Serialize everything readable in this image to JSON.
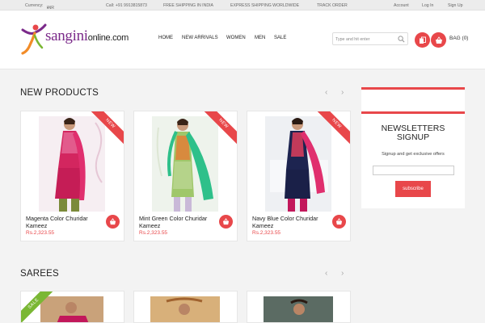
{
  "topbar": {
    "currency_label": "Currency:",
    "currency_value": "INR",
    "call": "Call: +91 9913815873",
    "free_shipping": "FREE SHIPPING IN INDIA",
    "express_shipping": "EXPRESS SHIPPING WORLDWIDE",
    "track_order": "TRACK ORDER",
    "account": "Account",
    "login": "Log In",
    "signup": "Sign Up"
  },
  "brand": {
    "name": "sangini",
    "suffix": "online.com"
  },
  "nav": [
    "HOME",
    "NEW ARRIVALS",
    "WOMEN",
    "MEN",
    "SALE"
  ],
  "search": {
    "placeholder": "Type and hit enter"
  },
  "bag": {
    "label": "BAG (0)"
  },
  "new_products": {
    "title": "NEW PRODUCTS",
    "items": [
      {
        "name": "Magenta Color Churidar Kameez",
        "price": "Rs.2,323.55",
        "badge": "NEW"
      },
      {
        "name": "Mint Green Color Churidar Kameez",
        "price": "Rs.2,323.55",
        "badge": "NEW"
      },
      {
        "name": "Navy Blue Color Churidar Kameez",
        "price": "Rs.2,323.55",
        "badge": "NEW"
      }
    ]
  },
  "newsletter": {
    "title_line1": "NEWSLETTERS",
    "title_line2": "SIGNUP",
    "subtitle": "Signup and get exclusive offers",
    "button": "subscribe"
  },
  "sarees": {
    "title": "SAREES",
    "items": [
      {
        "badge": "SALE"
      }
    ]
  },
  "colors": {
    "accent": "#e8474a",
    "sale_badge": "#7ab734"
  }
}
